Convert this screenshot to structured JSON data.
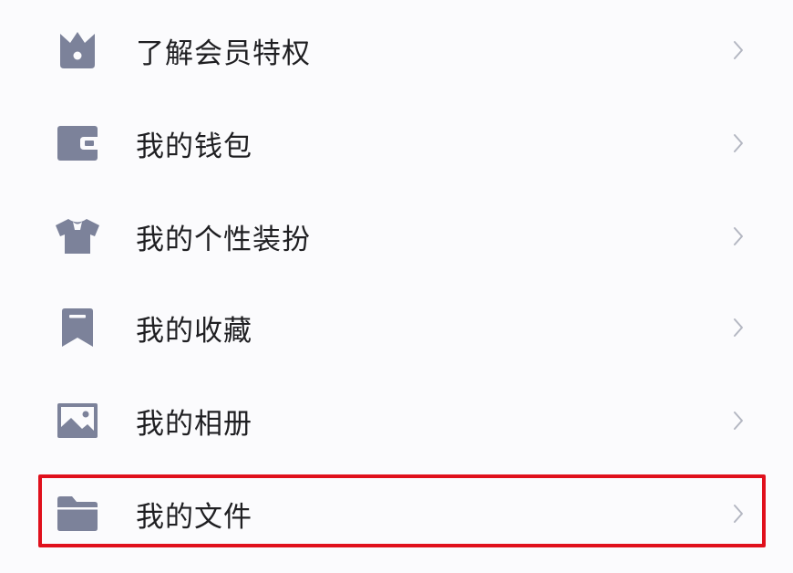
{
  "colors": {
    "background": "#fbfbfd",
    "icon": "#7c829a",
    "text": "#1f1f22",
    "chevron": "#b4b7c2",
    "highlight": "#e0101c"
  },
  "menu": {
    "items": [
      {
        "label": "了解会员特权",
        "icon": "crown-icon"
      },
      {
        "label": "我的钱包",
        "icon": "wallet-icon"
      },
      {
        "label": "我的个性装扮",
        "icon": "tshirt-icon"
      },
      {
        "label": "我的收藏",
        "icon": "bookmark-icon"
      },
      {
        "label": "我的相册",
        "icon": "image-icon"
      },
      {
        "label": "我的文件",
        "icon": "folder-icon",
        "highlighted": true
      }
    ],
    "chevron_icon": "chevron-right-icon"
  }
}
